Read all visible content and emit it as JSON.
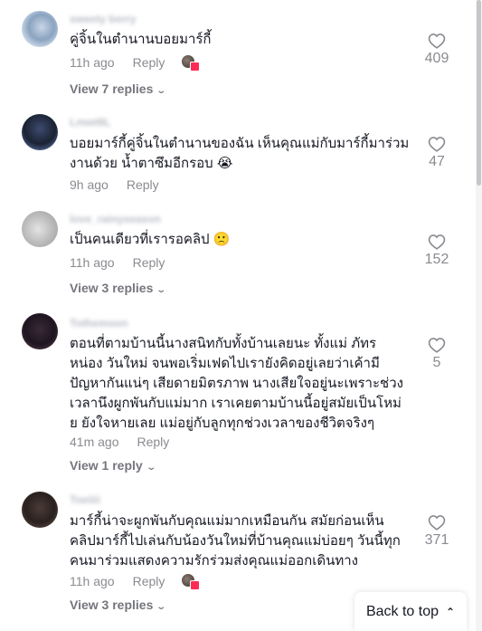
{
  "comments": [
    {
      "username": "sweety berry",
      "text": "คู่จิ้นในตำนานบอยมาร์กี้",
      "time": "11h ago",
      "reply_label": "Reply",
      "likes": "409",
      "view_replies": "View 7 replies"
    },
    {
      "username": "Lmwt6L",
      "text": "บอยมาร์กี้คู่จิ้นในตำนานของฉัน เห็นคุณแม่กับมาร์กี้มาร่วม\nงานด้วย น้ำตาซึมอีกรอบ 😭",
      "time": "9h ago",
      "reply_label": "Reply",
      "likes": "47"
    },
    {
      "username": "love_rainyseason",
      "text": "เป็นคนเดียวที่เรารอคลิป 🙁",
      "time": "11h ago",
      "reply_label": "Reply",
      "likes": "152",
      "view_replies": "View 3 replies"
    },
    {
      "username": "Tothemoon",
      "text": "ตอนที่ตามบ้านนี้นางสนิทกับทั้งบ้านเลยนะ ทั้งแม่ ภัทร\nหน่อง วันใหม่ จนพอเริ่มเฟดไปเรายังคิดอยู่เลยว่าเค้ามี\nปัญหากันแน่ๆ เสียดายมิตรภาพ นางเสียใจอยู่นะเพราะช่วง\nเวลานึงผูกพันกับแม่มาก เราเคยตามบ้านนี้อยู่สมัยเป็นโหม่\nย ยังใจหายเลย แม่อยู่กับลูกทุกช่วงเวลาของชีวิตจริงๆ",
      "time": "41m ago",
      "reply_label": "Reply",
      "likes": "5",
      "view_replies": "View 1 reply"
    },
    {
      "username": "Toeiiii",
      "text": "มาร์กี้น่าจะผูกพันกับคุณแม่มากเหมือนกัน สมัยก่อนเห็น\nคลิปมาร์กี้ไปเล่นกับน้องวันใหม่ที่บ้านคุณแม่บ่อยๆ วันนี้ทุก\nคนมาร่วมแสดงความรักร่วมส่งคุณแม่ออกเดินทาง",
      "time": "11h ago",
      "reply_label": "Reply",
      "likes": "371",
      "view_replies": "View 3 replies"
    }
  ],
  "back_to_top": "Back to top",
  "icons": {
    "like": "heart-outline-icon",
    "chevron": "chevron-down-icon",
    "back_to_top": "double-chevron-up-icon"
  },
  "colors": {
    "text": "#161823",
    "muted": "#8a8b91",
    "creator_badge": "#fe2c55"
  }
}
